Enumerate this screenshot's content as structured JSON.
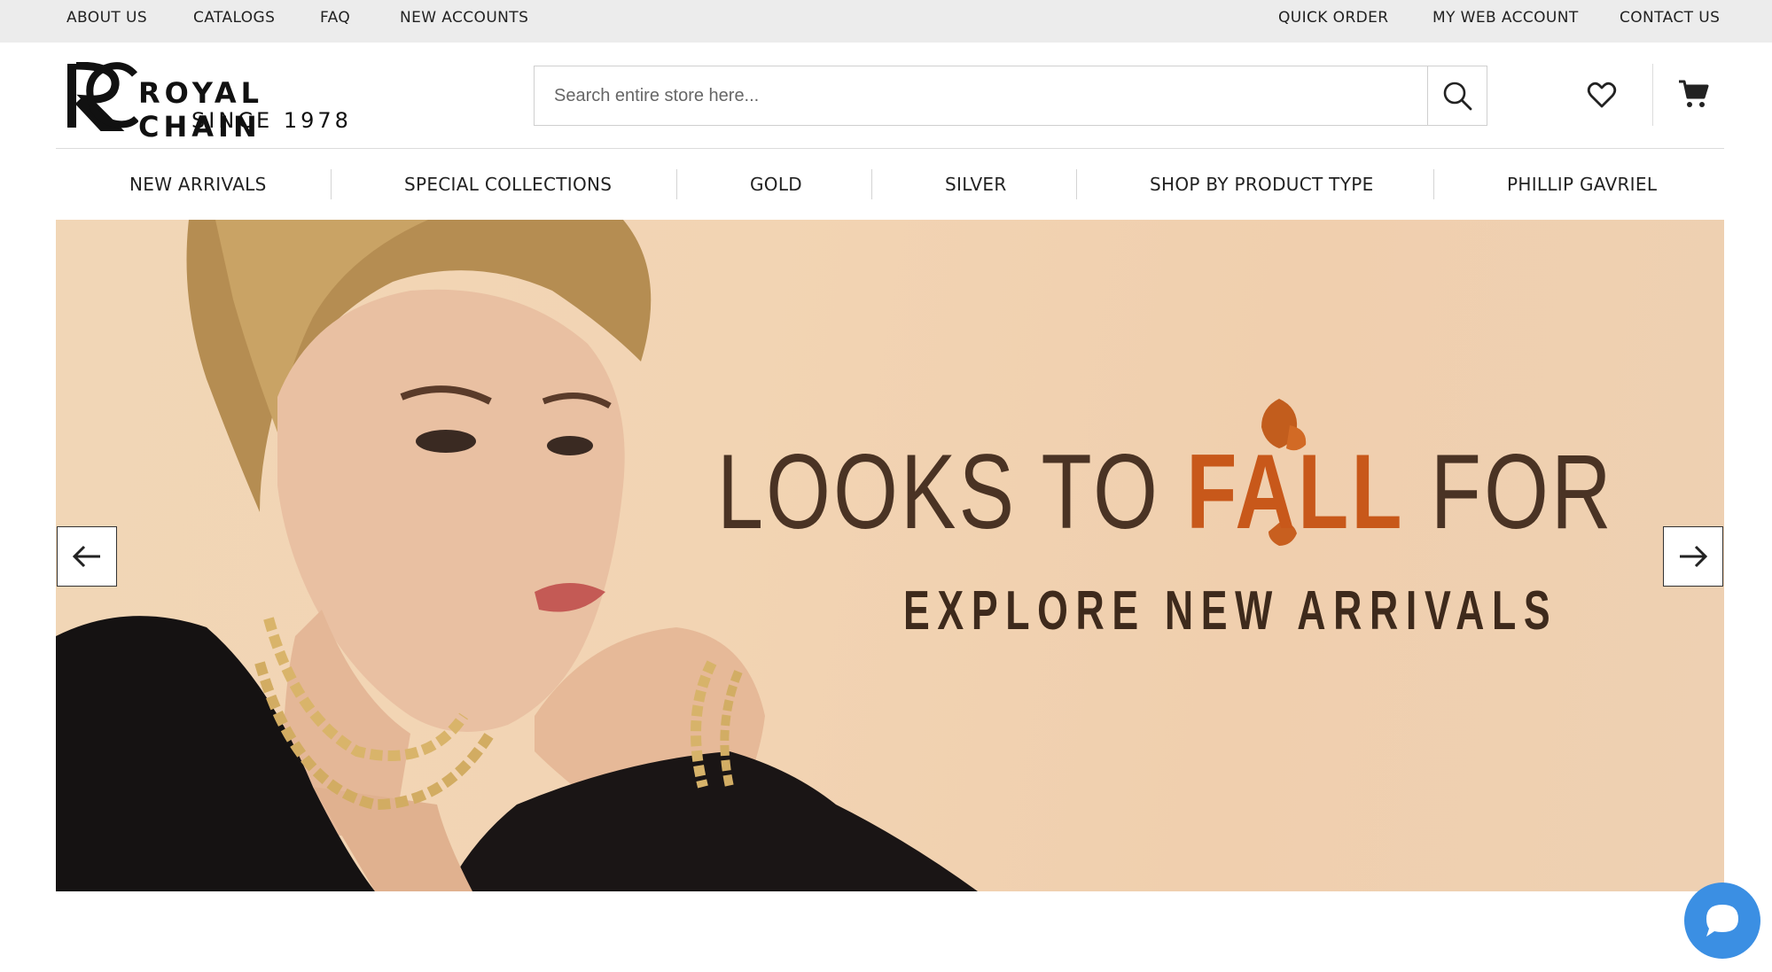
{
  "topbar": {
    "left_links": [
      "ABOUT US",
      "CATALOGS",
      "FAQ",
      "NEW ACCOUNTS"
    ],
    "right_links": [
      "QUICK ORDER",
      "MY WEB ACCOUNT",
      "CONTACT US"
    ]
  },
  "header": {
    "logo_line1": "ROYAL CHAIN",
    "logo_line2": "SINCE 1978",
    "search_placeholder": "Search entire store here...",
    "icons": [
      "search-icon",
      "heart-icon",
      "cart-icon"
    ]
  },
  "nav": {
    "items": [
      "NEW ARRIVALS",
      "SPECIAL COLLECTIONS",
      "GOLD",
      "SILVER",
      "SHOP BY PRODUCT TYPE",
      "PHILLIP GAVRIEL"
    ]
  },
  "hero": {
    "headline_pre": "LOOKS TO ",
    "headline_accent": "FALL",
    "headline_post": " FOR",
    "subhead": "EXPLORE NEW ARRIVALS",
    "accent_color": "#c8581a",
    "text_color": "#4a3324",
    "background_color": "#f1d4b4"
  },
  "chat": {
    "icon": "chat-icon",
    "color": "#3b8fe3"
  }
}
